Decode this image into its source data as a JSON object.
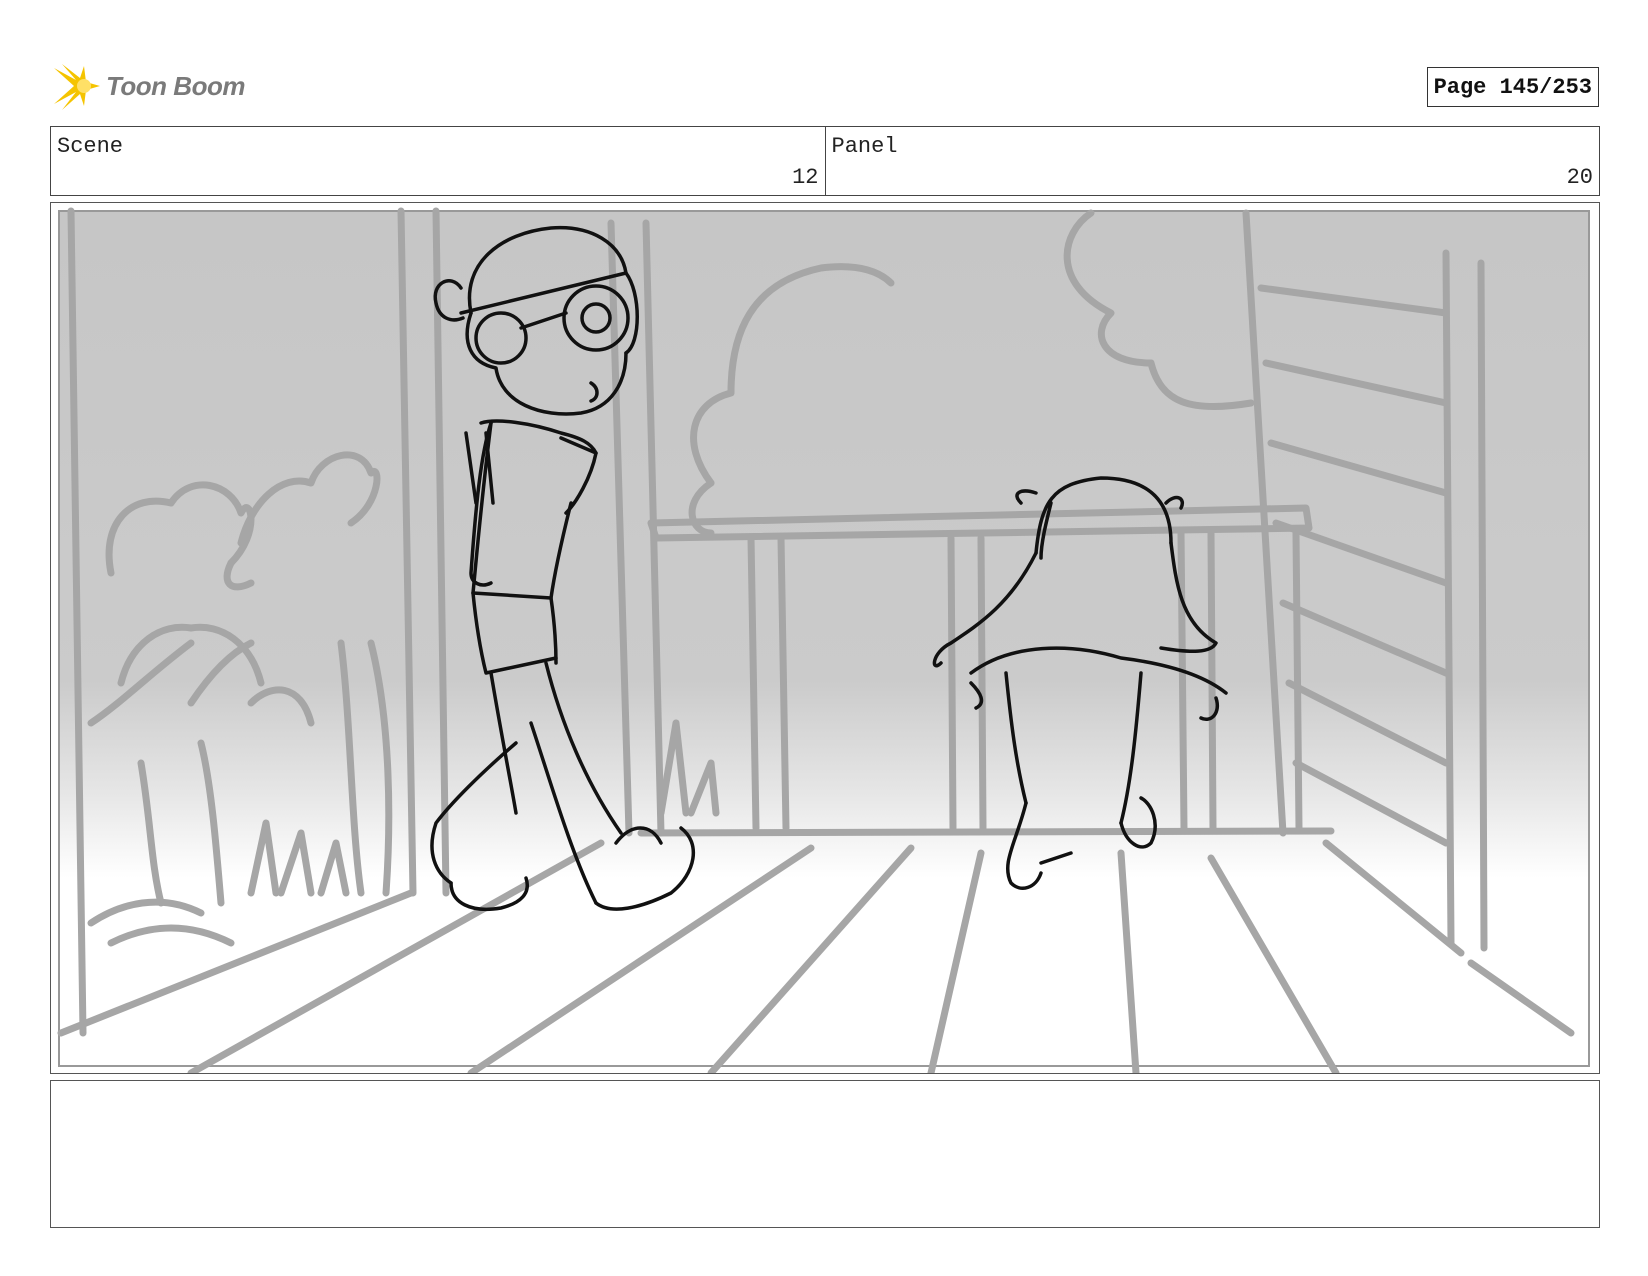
{
  "header": {
    "logo_text": "Toon Boom",
    "page_label": "Page 145/253"
  },
  "info": {
    "scene_label": "Scene",
    "scene_value": "12",
    "panel_label": "Panel",
    "panel_value": "20"
  },
  "notes": {
    "text": ""
  },
  "colors": {
    "sky_gray": "#c8c8c8",
    "sketch_gray": "#a8a8a8",
    "ink": "#111111",
    "logo_yellow": "#f5c400"
  }
}
